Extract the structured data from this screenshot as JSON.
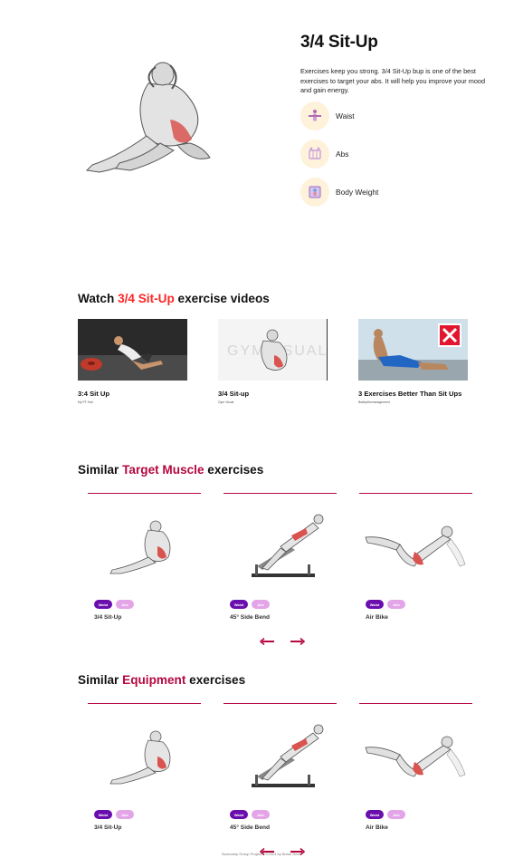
{
  "exercise": {
    "title": "3/4 Sit-Up",
    "description": "Exercises keep you strong. 3/4 Sit-Up bup is one of the best exercises to target your abs. It will help you improve your mood and gain energy.",
    "tags": [
      {
        "label": "Waist",
        "icon": "waist-body-part-icon"
      },
      {
        "label": "Abs",
        "icon": "abs-target-icon"
      },
      {
        "label": "Body Weight",
        "icon": "body-weight-equipment-icon"
      }
    ]
  },
  "videos_section": {
    "prefix": "Watch ",
    "highlight": "3/4 Sit-Up",
    "suffix": " exercise videos",
    "items": [
      {
        "title": "3:4 Sit Up",
        "channel": "My PT Hub"
      },
      {
        "title": "3/4 Sit-up",
        "channel": "Gym Visual"
      },
      {
        "title": "3 Exercises Better Than Sit Ups",
        "channel": "Bailey/themanagement"
      }
    ],
    "thumb_watermark": "GYMVISUAL"
  },
  "target_section": {
    "prefix": "Similar ",
    "highlight": "Target Muscle",
    "suffix": " exercises",
    "cards": [
      {
        "name": "3/4 Sit-Up",
        "chip1": "Waist",
        "chip2": "Abs"
      },
      {
        "name": "45° Side Bend",
        "chip1": "Waist",
        "chip2": "Abs"
      },
      {
        "name": "Air Bike",
        "chip1": "Waist",
        "chip2": "Abs"
      }
    ]
  },
  "equipment_section": {
    "prefix": "Similar ",
    "highlight": "Equipment",
    "suffix": " exercises",
    "cards": [
      {
        "name": "3/4 Sit-Up",
        "chip1": "Waist",
        "chip2": "Abs"
      },
      {
        "name": "45° Side Bend",
        "chip1": "Waist",
        "chip2": "Abs"
      },
      {
        "name": "Air Bike",
        "chip1": "Waist",
        "chip2": "Abs"
      }
    ]
  },
  "footer": {
    "text": "Bootcamp Group Project 2 ©2023 by Brese Deva"
  },
  "colors": {
    "accent": "#ff2625",
    "brand": "#b5083f",
    "chip_waist": "#6a0dad",
    "chip_abs": "#e3a4e8",
    "tag_bg": "#fff2da"
  }
}
